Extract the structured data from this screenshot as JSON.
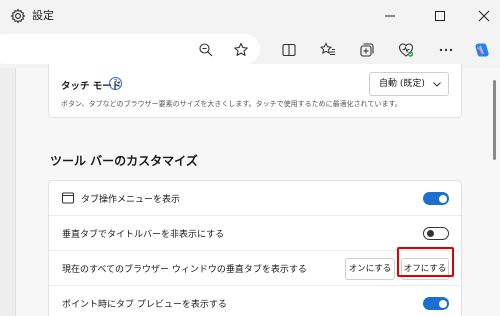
{
  "window": {
    "title": "設定",
    "gear_icon": "gear-icon",
    "minimize_icon": "minimize-icon",
    "maximize_icon": "maximize-icon",
    "close_icon": "close-icon"
  },
  "toolbar": {
    "icons": [
      "zoom-out-icon",
      "favorite-star-icon",
      "split-screen-icon",
      "favorites-icon",
      "collections-icon",
      "browser-essentials-icon",
      "more-icon",
      "copilot-icon"
    ]
  },
  "touch_mode": {
    "label": "タッチ モード",
    "description": "ボタン、タブなどのブラウザー要素のサイズを大きくします。タッチで使用するために最適化されています。",
    "dropdown_value": "自動 (既定)"
  },
  "section": {
    "title": "ツール バーのカスタマイズ"
  },
  "rows": [
    {
      "label": "タブ操作メニューを表示",
      "toggle": "on"
    },
    {
      "label": "垂直タブでタイトルバーを非表示にする",
      "toggle": "off"
    },
    {
      "label": "現在のすべてのブラウザー ウィンドウの垂直タブを表示する",
      "on_button": "オンにする",
      "off_button": "オフにする"
    },
    {
      "label": "ポイント時にタブ プレビューを表示する",
      "toggle": "on"
    }
  ],
  "colors": {
    "accent": "#1c6fd1",
    "highlight": "#e00000"
  }
}
